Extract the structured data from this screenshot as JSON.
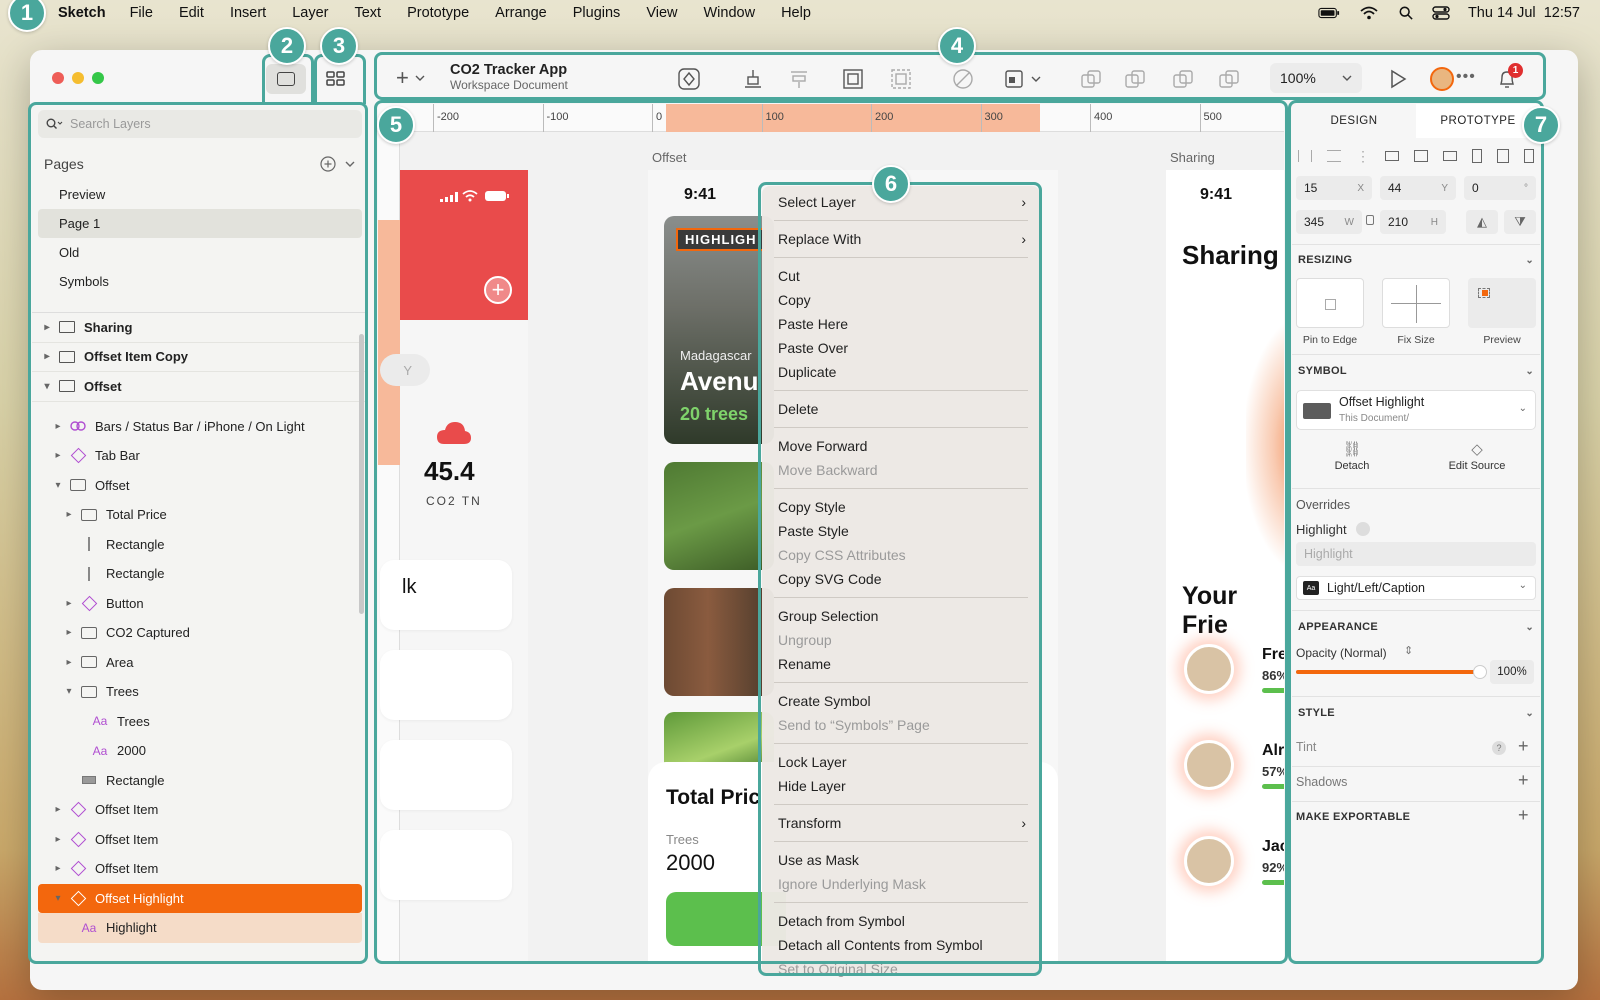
{
  "menubar": {
    "app": "Sketch",
    "items": [
      "File",
      "Edit",
      "Insert",
      "Layer",
      "Text",
      "Prototype",
      "Arrange",
      "Plugins",
      "View",
      "Window",
      "Help"
    ],
    "datetime": "Thu 14 Jul  12:57"
  },
  "annotations": [
    "1",
    "2",
    "3",
    "4",
    "5",
    "6",
    "7"
  ],
  "layers_panel": {
    "search_placeholder": "Search Layers",
    "pages_title": "Pages",
    "pages": [
      "Preview",
      "Page 1",
      "Old",
      "Symbols"
    ],
    "active_page": "Page 1",
    "artboards": [
      "Sharing",
      "Offset Item Copy",
      "Offset"
    ],
    "layers": [
      {
        "label": "Bars / Status Bar / iPhone / On Light",
        "icon": "link-icon",
        "indent": 1,
        "chev": "right"
      },
      {
        "label": "Tab Bar",
        "icon": "symbol-icon",
        "indent": 1,
        "chev": "right"
      },
      {
        "label": "Offset",
        "icon": "folder-icon",
        "indent": 1,
        "chev": "down"
      },
      {
        "label": "Total Price",
        "icon": "folder-icon",
        "indent": 2,
        "chev": "right"
      },
      {
        "label": "Rectangle",
        "icon": "line-icon",
        "indent": 2,
        "chev": ""
      },
      {
        "label": "Rectangle",
        "icon": "line-icon",
        "indent": 2,
        "chev": ""
      },
      {
        "label": "Button",
        "icon": "symbol-icon",
        "indent": 2,
        "chev": "right"
      },
      {
        "label": "CO2 Captured",
        "icon": "folder-icon",
        "indent": 2,
        "chev": "right"
      },
      {
        "label": "Area",
        "icon": "folder-icon",
        "indent": 2,
        "chev": "right"
      },
      {
        "label": "Trees",
        "icon": "folder-icon",
        "indent": 2,
        "chev": "down"
      },
      {
        "label": "Trees",
        "icon": "text-icon",
        "indent": 3,
        "chev": ""
      },
      {
        "label": "2000",
        "icon": "text-icon",
        "indent": 3,
        "chev": ""
      },
      {
        "label": "Rectangle",
        "icon": "rect-icon",
        "indent": 2,
        "chev": ""
      },
      {
        "label": "Offset Item",
        "icon": "symbol-icon",
        "indent": 1,
        "chev": "right"
      },
      {
        "label": "Offset Item",
        "icon": "symbol-icon",
        "indent": 1,
        "chev": "right"
      },
      {
        "label": "Offset Item",
        "icon": "symbol-icon",
        "indent": 1,
        "chev": "right"
      },
      {
        "label": "Offset Highlight",
        "icon": "symbol-icon",
        "indent": 1,
        "chev": "down",
        "selected": true
      },
      {
        "label": "Highlight",
        "icon": "text-icon",
        "indent": 2,
        "chev": "",
        "subselected": true
      }
    ]
  },
  "toolbar": {
    "doc_title": "CO2 Tracker App",
    "doc_subtitle": "Workspace Document",
    "zoom": "100%",
    "notification_count": "1"
  },
  "canvas": {
    "ruler_ticks": [
      "-200",
      "-100",
      "0",
      "100",
      "200",
      "300",
      "400",
      "500"
    ],
    "artboard_offset_label": "Offset",
    "artboard_sharing_label": "Sharing",
    "left_phone": {
      "co2_value": "45.4",
      "co2_unit": "CO2 TN",
      "pill_text": "Y",
      "card_text": "lk"
    },
    "offset_phone": {
      "time": "9:41",
      "highlight_tag": "HIGHLIGH",
      "place": "Madagascar",
      "title": "Avenu",
      "trees": "20 trees",
      "total_price": "Total Pric",
      "trees_label": "Trees",
      "trees_value": "2000"
    },
    "sharing_phone": {
      "time": "9:41",
      "title": "Sharing",
      "friends_title": "Your Frie",
      "friends": [
        {
          "name": "Fre",
          "pct": "86%"
        },
        {
          "name": "Alr",
          "pct": "57%"
        },
        {
          "name": "Jac",
          "pct": "92%"
        }
      ]
    }
  },
  "context_menu": {
    "groups": [
      [
        {
          "label": "Select Layer",
          "sub": true
        }
      ],
      [
        {
          "label": "Replace With",
          "sub": true
        }
      ],
      [
        {
          "label": "Cut"
        },
        {
          "label": "Copy"
        },
        {
          "label": "Paste Here"
        },
        {
          "label": "Paste Over"
        },
        {
          "label": "Duplicate"
        }
      ],
      [
        {
          "label": "Delete"
        }
      ],
      [
        {
          "label": "Move Forward"
        },
        {
          "label": "Move Backward",
          "disabled": true
        }
      ],
      [
        {
          "label": "Copy Style"
        },
        {
          "label": "Paste Style"
        },
        {
          "label": "Copy CSS Attributes",
          "disabled": true
        },
        {
          "label": "Copy SVG Code"
        }
      ],
      [
        {
          "label": "Group Selection"
        },
        {
          "label": "Ungroup",
          "disabled": true
        },
        {
          "label": "Rename"
        }
      ],
      [
        {
          "label": "Create Symbol"
        },
        {
          "label": "Send to “Symbols” Page",
          "disabled": true
        }
      ],
      [
        {
          "label": "Lock Layer"
        },
        {
          "label": "Hide Layer"
        }
      ],
      [
        {
          "label": "Transform",
          "sub": true
        }
      ],
      [
        {
          "label": "Use as Mask"
        },
        {
          "label": "Ignore Underlying Mask",
          "disabled": true
        }
      ],
      [
        {
          "label": "Detach from Symbol"
        },
        {
          "label": "Detach all Contents from Symbol"
        },
        {
          "label": "Set to Original Size",
          "disabled": true
        }
      ]
    ]
  },
  "inspector": {
    "tab_design": "DESIGN",
    "tab_prototype": "PROTOTYPE",
    "x": "15",
    "x_unit": "X",
    "y": "44",
    "y_unit": "Y",
    "rotation": "0",
    "rotation_unit": "°",
    "w": "345",
    "w_unit": "W",
    "h": "210",
    "h_unit": "H",
    "resizing_title": "RESIZING",
    "pin_label": "Pin to Edge",
    "fix_label": "Fix Size",
    "preview_label": "Preview",
    "symbol_title": "SYMBOL",
    "symbol_name": "Offset Highlight",
    "symbol_source": "This Document/",
    "detach_label": "Detach",
    "edit_source_label": "Edit Source",
    "overrides_title": "Overrides",
    "override_name": "Highlight",
    "override_placeholder": "Highlight",
    "text_style": "Light/Left/Caption",
    "text_style_icon": "Aa",
    "appearance_title": "APPEARANCE",
    "opacity_label": "Opacity (Normal)",
    "opacity_value": "100%",
    "opacity_fraction": 1.0,
    "style_title": "STYLE",
    "tint_label": "Tint",
    "shadows_label": "Shadows",
    "exportable_title": "MAKE EXPORTABLE"
  },
  "colors": {
    "accent": "#f3670d",
    "highlight_ring": "#4aa79c",
    "red_header": "#e94b4b",
    "green_button": "#5cbf4d"
  }
}
